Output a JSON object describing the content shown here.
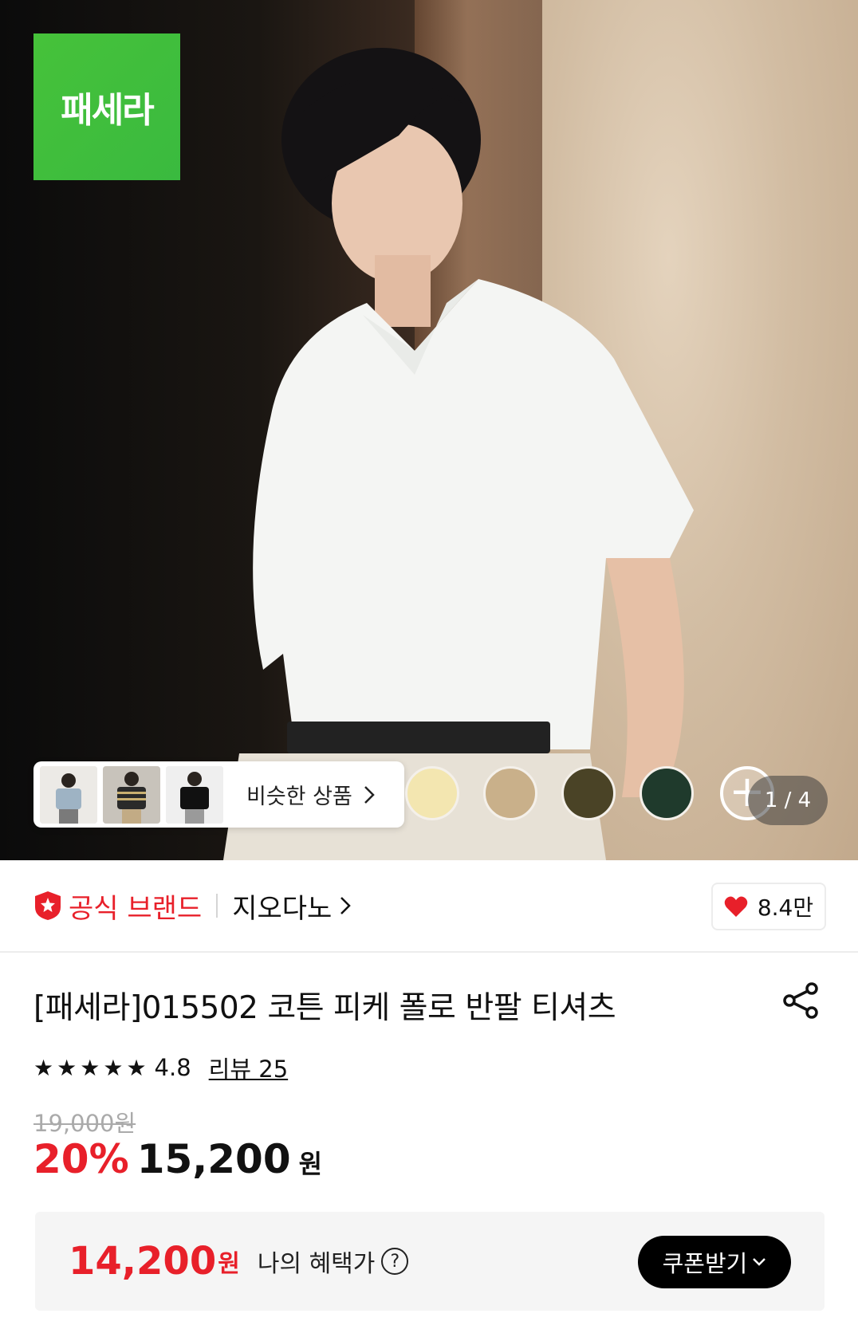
{
  "hero": {
    "brand_logo_text": "패세라",
    "similar_label": "비슷한 상품",
    "page_indicator": "1 / 4",
    "swatches": [
      "#f3e6b0",
      "#c9b08a",
      "#4a4326",
      "#1f3a2c"
    ]
  },
  "brand": {
    "official_label": "공식 브랜드",
    "name": "지오다노",
    "likes": "8.4만"
  },
  "product": {
    "title": "[패세라]015502 코튼 피케 폴로 반팔 티셔츠",
    "rating_value": "4.8",
    "reviews_label": "리뷰 25",
    "original_price": "19,000원",
    "discount": "20%",
    "sale_price": "15,200",
    "currency": "원"
  },
  "benefit": {
    "price": "14,200",
    "currency": "원",
    "label": "나의 혜택가",
    "coupon_button": "쿠폰받기"
  },
  "colors": {
    "accent_red": "#e8202a",
    "logo_green": "#3fbd3c"
  }
}
